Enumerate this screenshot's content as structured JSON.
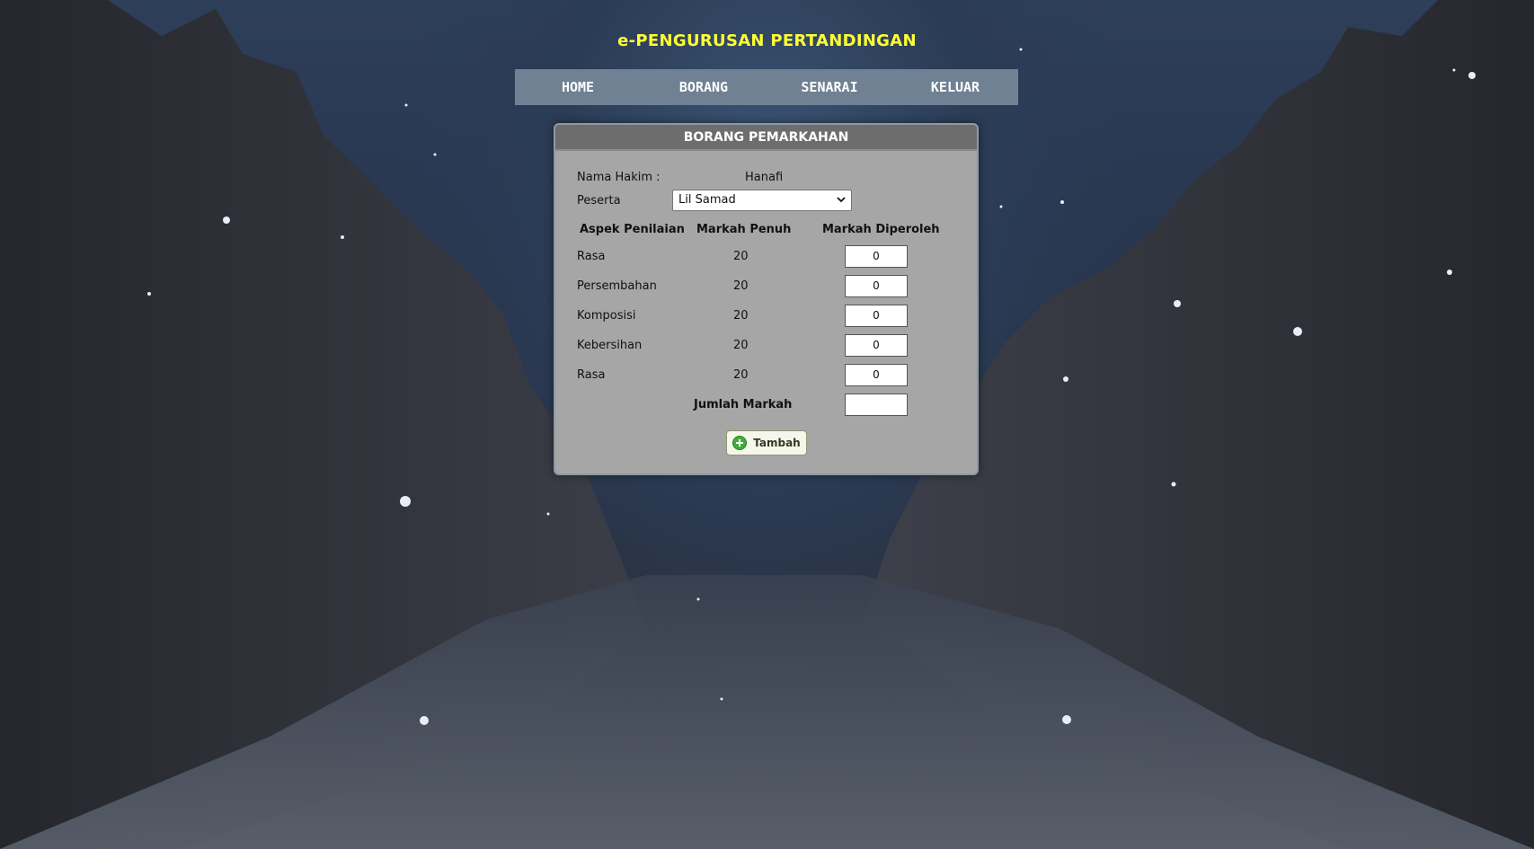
{
  "app_title": "e-PENGURUSAN PERTANDINGAN",
  "nav": [
    {
      "label": "HOME"
    },
    {
      "label": "BORANG"
    },
    {
      "label": "SENARAI"
    },
    {
      "label": "KELUAR"
    }
  ],
  "form": {
    "header": "BORANG PEMARKAHAN",
    "judge_label": "Nama Hakim :",
    "judge_name": "Hanafi",
    "participant_label": "Peserta",
    "participant_selected": "Lil Samad",
    "columns": {
      "aspect": "Aspek Penilaian",
      "full": "Markah Penuh",
      "obtained": "Markah Diperoleh"
    },
    "rows": [
      {
        "aspect": "Rasa",
        "full": "20",
        "obtained": "0"
      },
      {
        "aspect": "Persembahan",
        "full": "20",
        "obtained": "0"
      },
      {
        "aspect": "Komposisi",
        "full": "20",
        "obtained": "0"
      },
      {
        "aspect": "Kebersihan",
        "full": "20",
        "obtained": "0"
      },
      {
        "aspect": "Rasa",
        "full": "20",
        "obtained": "0"
      }
    ],
    "total_label": "Jumlah Markah",
    "total_value": "",
    "submit_label": "Tambah"
  },
  "colors": {
    "title": "#ffff33",
    "nav_bg": "#6f8193",
    "panel_bg": "#a6a6a6",
    "panel_header": "#6d6d6d",
    "button_icon": "#3fae3a"
  },
  "icons": {
    "select_arrow": "chevron-down-icon",
    "submit": "plus-circle-icon"
  }
}
